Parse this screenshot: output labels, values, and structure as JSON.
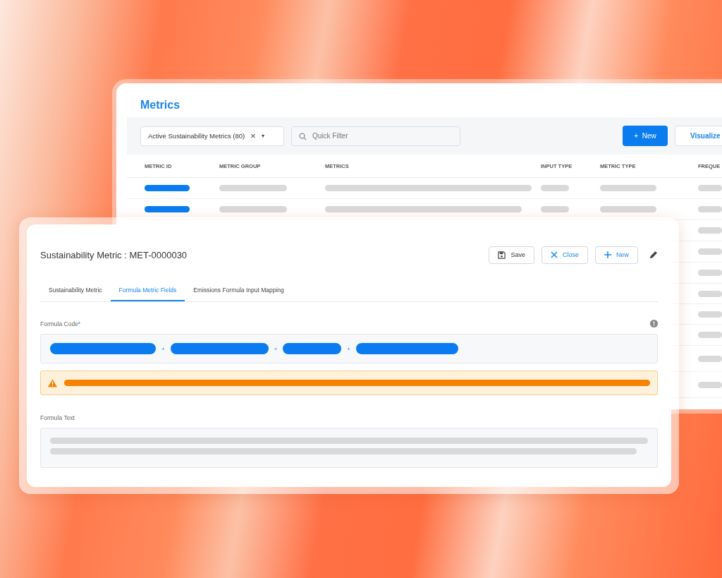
{
  "list_window": {
    "title": "Metrics",
    "view_filter": {
      "label": "Active Sustainability Metrics (80)",
      "clear_icon": "×",
      "caret_icon": "▾"
    },
    "search": {
      "placeholder": "Quick Filter"
    },
    "buttons": [
      {
        "kind": "primary",
        "label": "New",
        "icon": "+"
      },
      {
        "kind": "secondary",
        "label": "Visualize"
      }
    ],
    "table": {
      "columns": [
        "METRIC ID",
        "METRIC GROUP",
        "METRICS",
        "INPUT TYPE",
        "METRIC TYPE",
        "FREQUE"
      ]
    }
  },
  "detail_window": {
    "title": "Sustainability Metric : MET-0000030",
    "buttons": [
      {
        "kind": "save",
        "label": "Save"
      },
      {
        "kind": "close",
        "label": "Close"
      },
      {
        "kind": "new",
        "label": "New"
      }
    ],
    "tabs": [
      {
        "label": "Sustainability Metric",
        "selected": false
      },
      {
        "label": "Formula Metric Fields",
        "selected": true
      },
      {
        "label": "Emissions Formula Input Mapping",
        "selected": false
      }
    ],
    "formula_code": {
      "label": "Formula Code",
      "required_mark": "*",
      "operators": [
        "+",
        "+",
        "+"
      ]
    },
    "formula_text": {
      "label": "Formula Text"
    }
  }
}
